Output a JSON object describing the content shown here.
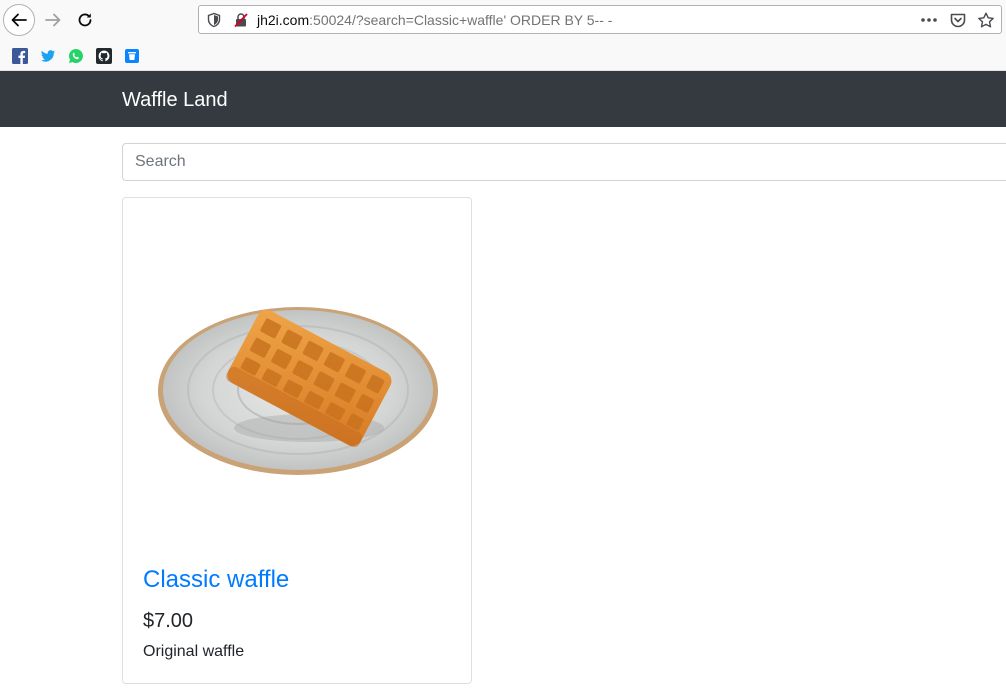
{
  "browser": {
    "url": {
      "host": "jh2i.com",
      "rest": ":50024/?search=Classic+waffle' ORDER BY 5-- -"
    },
    "icons": [
      "back-arrow-icon",
      "forward-arrow-icon",
      "reload-icon",
      "shield-icon",
      "insecure-lock-icon",
      "more-dots-icon",
      "pocket-icon",
      "star-icon"
    ],
    "bookmarks": [
      "facebook-icon",
      "twitter-icon",
      "whatsapp-icon",
      "github-icon",
      "trash-icon"
    ]
  },
  "navbar": {
    "brand": "Waffle Land"
  },
  "search": {
    "placeholder": "Search"
  },
  "products": [
    {
      "title": "Classic waffle",
      "price": "$7.00",
      "description": "Original waffle"
    }
  ],
  "colors": {
    "navbar_bg": "#343a40",
    "link": "#007bff",
    "text": "#212529"
  }
}
